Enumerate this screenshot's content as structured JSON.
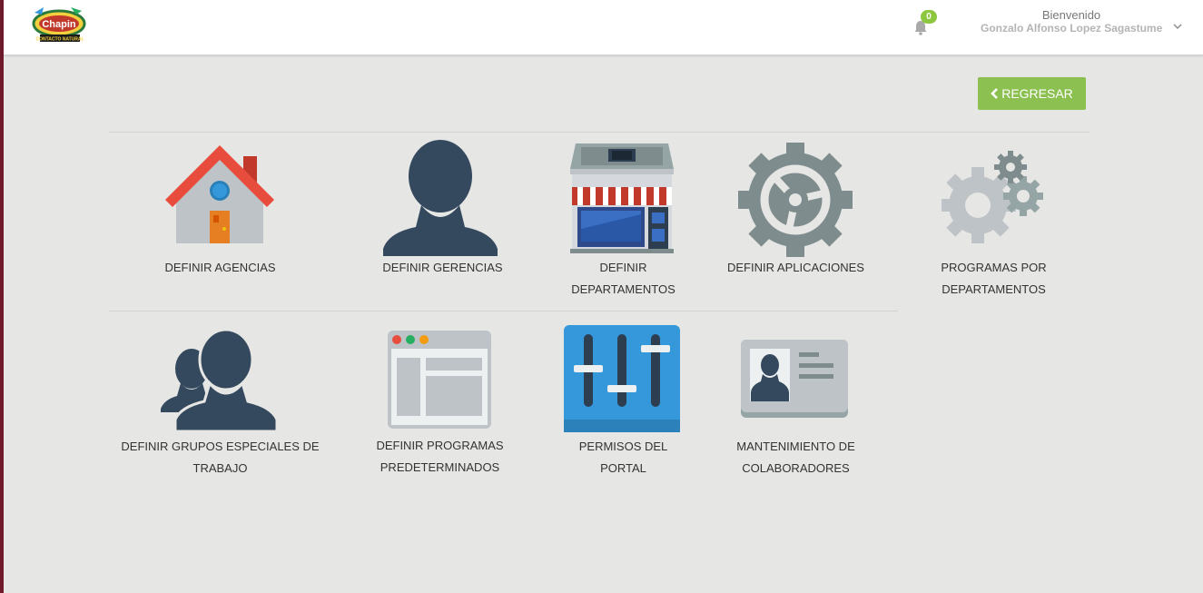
{
  "header": {
    "logo_text": "Chapin",
    "logo_subtext": "CONTACTO NATURAL",
    "notifications_count": "0",
    "welcome": "Bienvenido",
    "user_name": "Gonzalo Alfonso Lopez Sagastume"
  },
  "actions": {
    "back_label": "REGRESAR"
  },
  "tiles": [
    {
      "label_line1": "DEFINIR AGENCIAS",
      "label_line2": "",
      "icon": "house-icon"
    },
    {
      "label_line1": "DEFINIR GERENCIAS",
      "label_line2": "",
      "icon": "person-icon"
    },
    {
      "label_line1": "DEFINIR",
      "label_line2": "DEPARTAMENTOS",
      "icon": "store-icon"
    },
    {
      "label_line1": "DEFINIR APLICACIONES",
      "label_line2": "",
      "icon": "gear-icon"
    },
    {
      "label_line1": "PROGRAMAS POR",
      "label_line2": "DEPARTAMENTOS",
      "icon": "gears-icon"
    },
    {
      "label_line1": "DEFINIR GRUPOS ESPECIALES DE",
      "label_line2": "TRABAJO",
      "icon": "group-icon"
    },
    {
      "label_line1": "DEFINIR PROGRAMAS",
      "label_line2": "PREDETERMINADOS",
      "icon": "browser-window-icon"
    },
    {
      "label_line1": "PERMISOS DEL",
      "label_line2": "PORTAL",
      "icon": "sliders-icon"
    },
    {
      "label_line1": "MANTENIMIENTO DE",
      "label_line2": "COLABORADORES",
      "icon": "id-card-icon"
    }
  ],
  "colors": {
    "accent_green": "#8cc152",
    "icon_navy": "#34495e",
    "gear_gray": "#7f8c8d",
    "house_red": "#e74c3c",
    "sliders_blue": "#3498db"
  }
}
